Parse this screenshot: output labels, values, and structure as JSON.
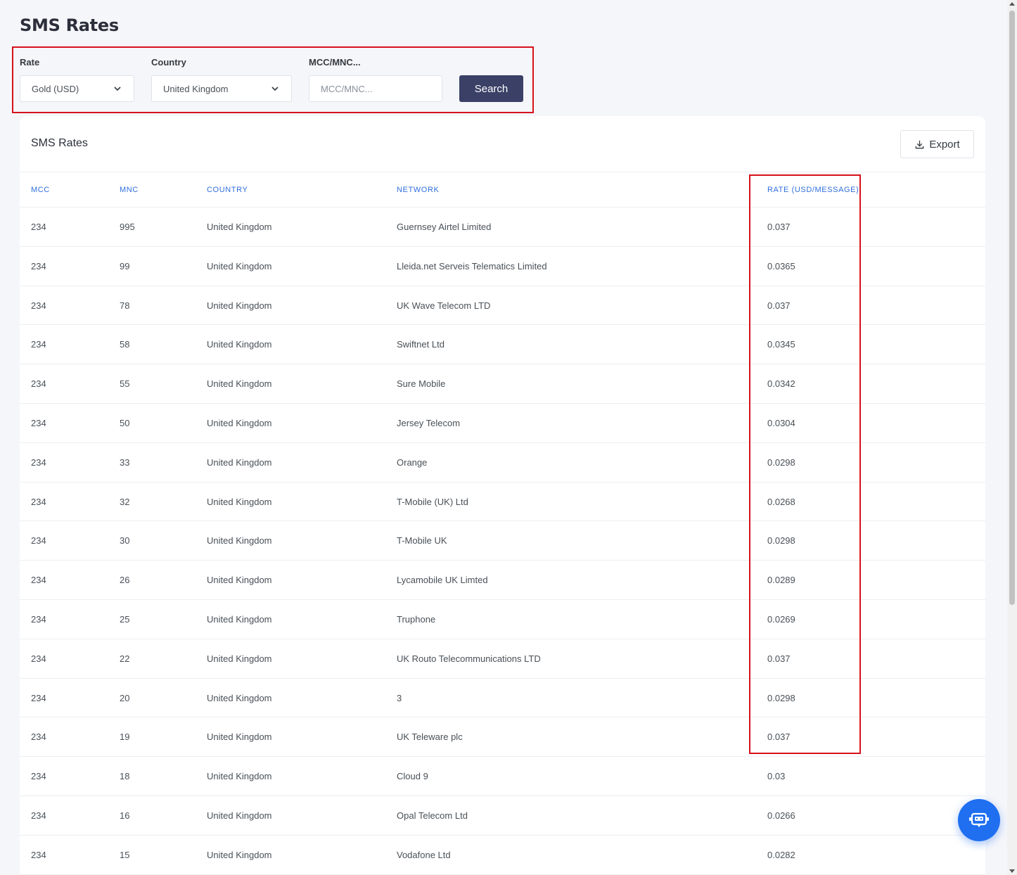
{
  "page": {
    "title": "SMS Rates"
  },
  "filters": {
    "rate": {
      "label": "Rate",
      "value": "Gold (USD)"
    },
    "country": {
      "label": "Country",
      "value": "United Kingdom"
    },
    "mccmnc": {
      "label": "MCC/MNC...",
      "placeholder": "MCC/MNC..."
    },
    "search_label": "Search"
  },
  "card": {
    "title": "SMS Rates",
    "export_label": "Export"
  },
  "table": {
    "headers": {
      "mcc": "MCC",
      "mnc": "MNC",
      "country": "COUNTRY",
      "network": "NETWORK",
      "rate": "RATE (USD/MESSAGE)"
    },
    "rows": [
      {
        "mcc": "234",
        "mnc": "995",
        "country": "United Kingdom",
        "network": "Guernsey Airtel Limited",
        "rate": "0.037"
      },
      {
        "mcc": "234",
        "mnc": "99",
        "country": "United Kingdom",
        "network": "Lleida.net Serveis Telematics Limited",
        "rate": "0.0365"
      },
      {
        "mcc": "234",
        "mnc": "78",
        "country": "United Kingdom",
        "network": "UK Wave Telecom LTD",
        "rate": "0.037"
      },
      {
        "mcc": "234",
        "mnc": "58",
        "country": "United Kingdom",
        "network": "Swiftnet Ltd",
        "rate": "0.0345"
      },
      {
        "mcc": "234",
        "mnc": "55",
        "country": "United Kingdom",
        "network": "Sure Mobile",
        "rate": "0.0342"
      },
      {
        "mcc": "234",
        "mnc": "50",
        "country": "United Kingdom",
        "network": "Jersey Telecom",
        "rate": "0.0304"
      },
      {
        "mcc": "234",
        "mnc": "33",
        "country": "United Kingdom",
        "network": "Orange",
        "rate": "0.0298"
      },
      {
        "mcc": "234",
        "mnc": "32",
        "country": "United Kingdom",
        "network": "T-Mobile (UK) Ltd",
        "rate": "0.0268"
      },
      {
        "mcc": "234",
        "mnc": "30",
        "country": "United Kingdom",
        "network": "T-Mobile UK",
        "rate": "0.0298"
      },
      {
        "mcc": "234",
        "mnc": "26",
        "country": "United Kingdom",
        "network": "Lycamobile UK Limted",
        "rate": "0.0289"
      },
      {
        "mcc": "234",
        "mnc": "25",
        "country": "United Kingdom",
        "network": "Truphone",
        "rate": "0.0269"
      },
      {
        "mcc": "234",
        "mnc": "22",
        "country": "United Kingdom",
        "network": "UK Routo Telecommunications LTD",
        "rate": "0.037"
      },
      {
        "mcc": "234",
        "mnc": "20",
        "country": "United Kingdom",
        "network": "3",
        "rate": "0.0298"
      },
      {
        "mcc": "234",
        "mnc": "19",
        "country": "United Kingdom",
        "network": "UK Teleware plc",
        "rate": "0.037"
      },
      {
        "mcc": "234",
        "mnc": "18",
        "country": "United Kingdom",
        "network": "Cloud 9",
        "rate": "0.03"
      },
      {
        "mcc": "234",
        "mnc": "16",
        "country": "United Kingdom",
        "network": "Opal Telecom Ltd",
        "rate": "0.0266"
      },
      {
        "mcc": "234",
        "mnc": "15",
        "country": "United Kingdom",
        "network": "Vodafone Ltd",
        "rate": "0.0282"
      }
    ]
  },
  "icons": {
    "select": "chevron-down-icon",
    "export": "download-icon",
    "chat": "chatbot-icon"
  },
  "colors": {
    "accent": "#3a4066",
    "header_text": "#2f6fdc",
    "highlight": "#d6121b",
    "chat": "#1f6ff0"
  }
}
